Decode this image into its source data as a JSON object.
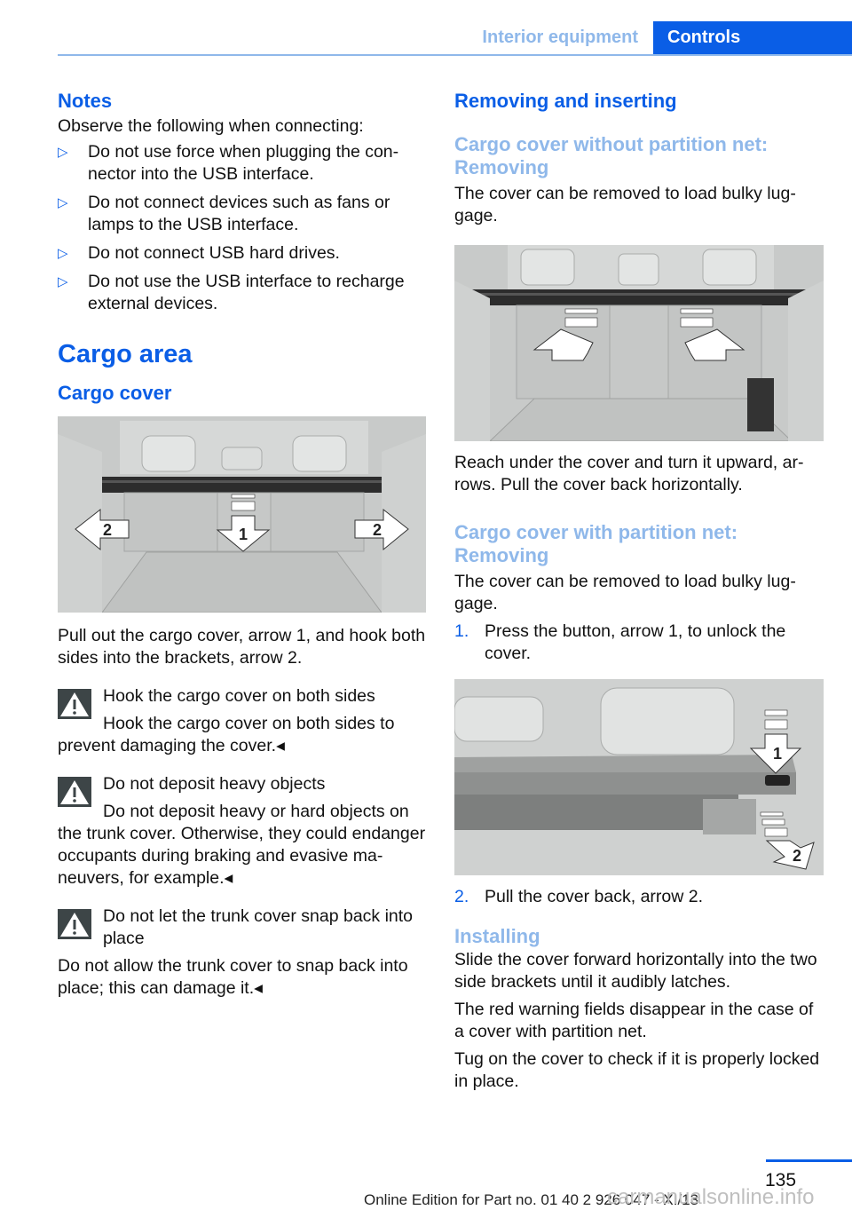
{
  "header": {
    "section": "Interior equipment",
    "tab": "Controls"
  },
  "left": {
    "notes_title": "Notes",
    "notes_intro": "Observe the following when connecting:",
    "notes_items": [
      "Do not use force when plugging the con­nector into the USB interface.",
      "Do not connect devices such as fans or lamps to the USB interface.",
      "Do not connect USB hard drives.",
      "Do not use the USB interface to recharge external devices."
    ],
    "bullet_glyph": "▷",
    "cargo_area_title": "Cargo area",
    "cargo_cover_title": "Cargo cover",
    "figure1": {
      "labels": [
        "2",
        "1",
        "2"
      ]
    },
    "cargo_cover_text": "Pull out the cargo cover, arrow 1, and hook both sides into the brackets, arrow 2.",
    "warnings": [
      {
        "title": "Hook the cargo cover on both sides",
        "body": "Hook the cargo cover on both sides to prevent damaging the cover.◂"
      },
      {
        "title": "Do not deposit heavy objects",
        "body": "Do not deposit heavy or hard objects on the trunk cover. Otherwise, they could endan­ger occupants during braking and evasive ma­neuvers, for example.◂"
      },
      {
        "title": "Do not let the trunk cover snap back into place",
        "body": "Do not allow the trunk cover to snap back into place; this can damage it.◂"
      }
    ]
  },
  "right": {
    "removing_title": "Removing and inserting",
    "without_net_title": "Cargo cover without partition net: Removing",
    "without_net_text": "The cover can be removed to load bulky lug­gage.",
    "figure2_caption": "Reach under the cover and turn it upward, ar­rows. Pull the cover back horizontally.",
    "with_net_title": "Cargo cover with partition net: Removing",
    "with_net_text": "The cover can be removed to load bulky lug­gage.",
    "steps": [
      {
        "num": "1.",
        "text": "Press the button, arrow 1, to unlock the cover."
      },
      {
        "num": "2.",
        "text": "Pull the cover back, arrow 2."
      }
    ],
    "figure3": {
      "labels": [
        "1",
        "2"
      ]
    },
    "installing_title": "Installing",
    "installing_paras": [
      "Slide the cover forward horizontally into the two side brackets until it audibly latches.",
      "The red warning fields disappear in the case of a cover with partition net.",
      "Tug on the cover to check if it is properly locked in place."
    ]
  },
  "footer": {
    "page_number": "135",
    "edition": "Online Edition for Part no. 01 40 2 926 047 - XI/13",
    "watermark": "carmanualsonline.info"
  }
}
